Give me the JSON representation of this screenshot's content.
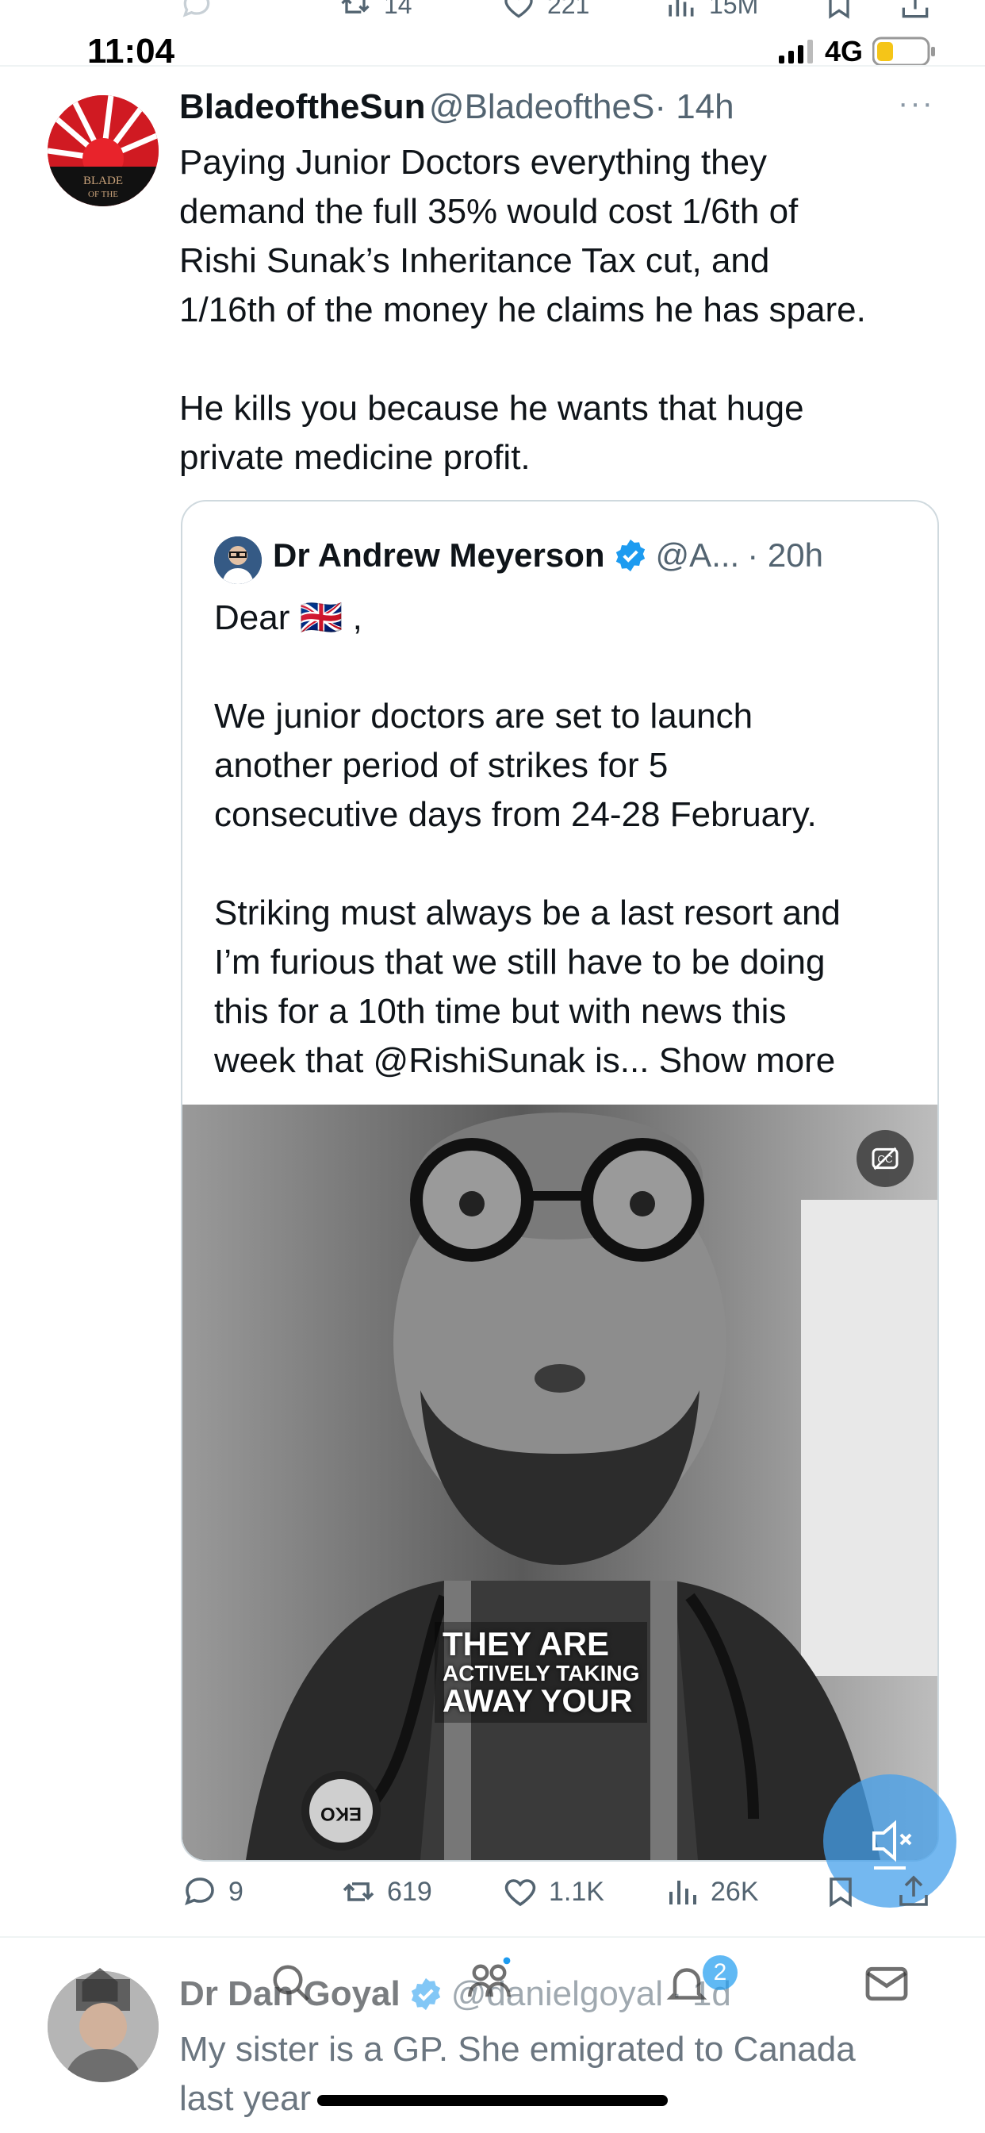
{
  "top_actions": {
    "replies": "",
    "retweets": "14",
    "likes": "221",
    "views": "15M"
  },
  "status_bar": {
    "time": "11:04",
    "network": "4G"
  },
  "tweet": {
    "name": "BladeoftheSun",
    "handle": "@BladeoftheS",
    "time": "· 14h",
    "more": "···",
    "text": "Paying Junior Doctors everything they\ndemand the full 35% would cost 1/6th of\nRishi Sunak’s Inheritance Tax cut, and\n1/16th of the money he claims he has spare.\n\nHe kills you because he wants that huge\nprivate medicine profit.",
    "avatar_text": "BLADE\nOF THE\nSUN"
  },
  "quote": {
    "name": "Dr Andrew Meyerson",
    "handle": "@A...",
    "time": "· 20h",
    "text": "Dear 🇬🇧 ,\n\nWe junior doctors are set to launch\nanother period of strikes for 5\nconsecutive days from 24-28 February.\n\nStriking must always be a last resort and\nI’m furious that we still have to be doing\nthis for a 10th time but with news this\nweek that @RishiSunak is...",
    "show_more": "Show more",
    "video_caption": {
      "line1": "THEY ARE",
      "line2": "ACTIVELY TAKING",
      "line3": "AWAY YOUR"
    }
  },
  "stats": {
    "replies": "9",
    "retweets": "619",
    "likes": "1.1K",
    "views": "26K"
  },
  "next_tweet": {
    "name": "Dr Dan Goyal",
    "handle": "@danielgoyal",
    "time": "· 1d",
    "text": "My sister is a GP. She emigrated to Canada\nlast year"
  },
  "tabbar": {
    "notifications_badge": "2"
  },
  "colors": {
    "accent": "#1d9bf0",
    "text": "#0f1419",
    "muted": "#536471",
    "border": "#cfd9de"
  }
}
